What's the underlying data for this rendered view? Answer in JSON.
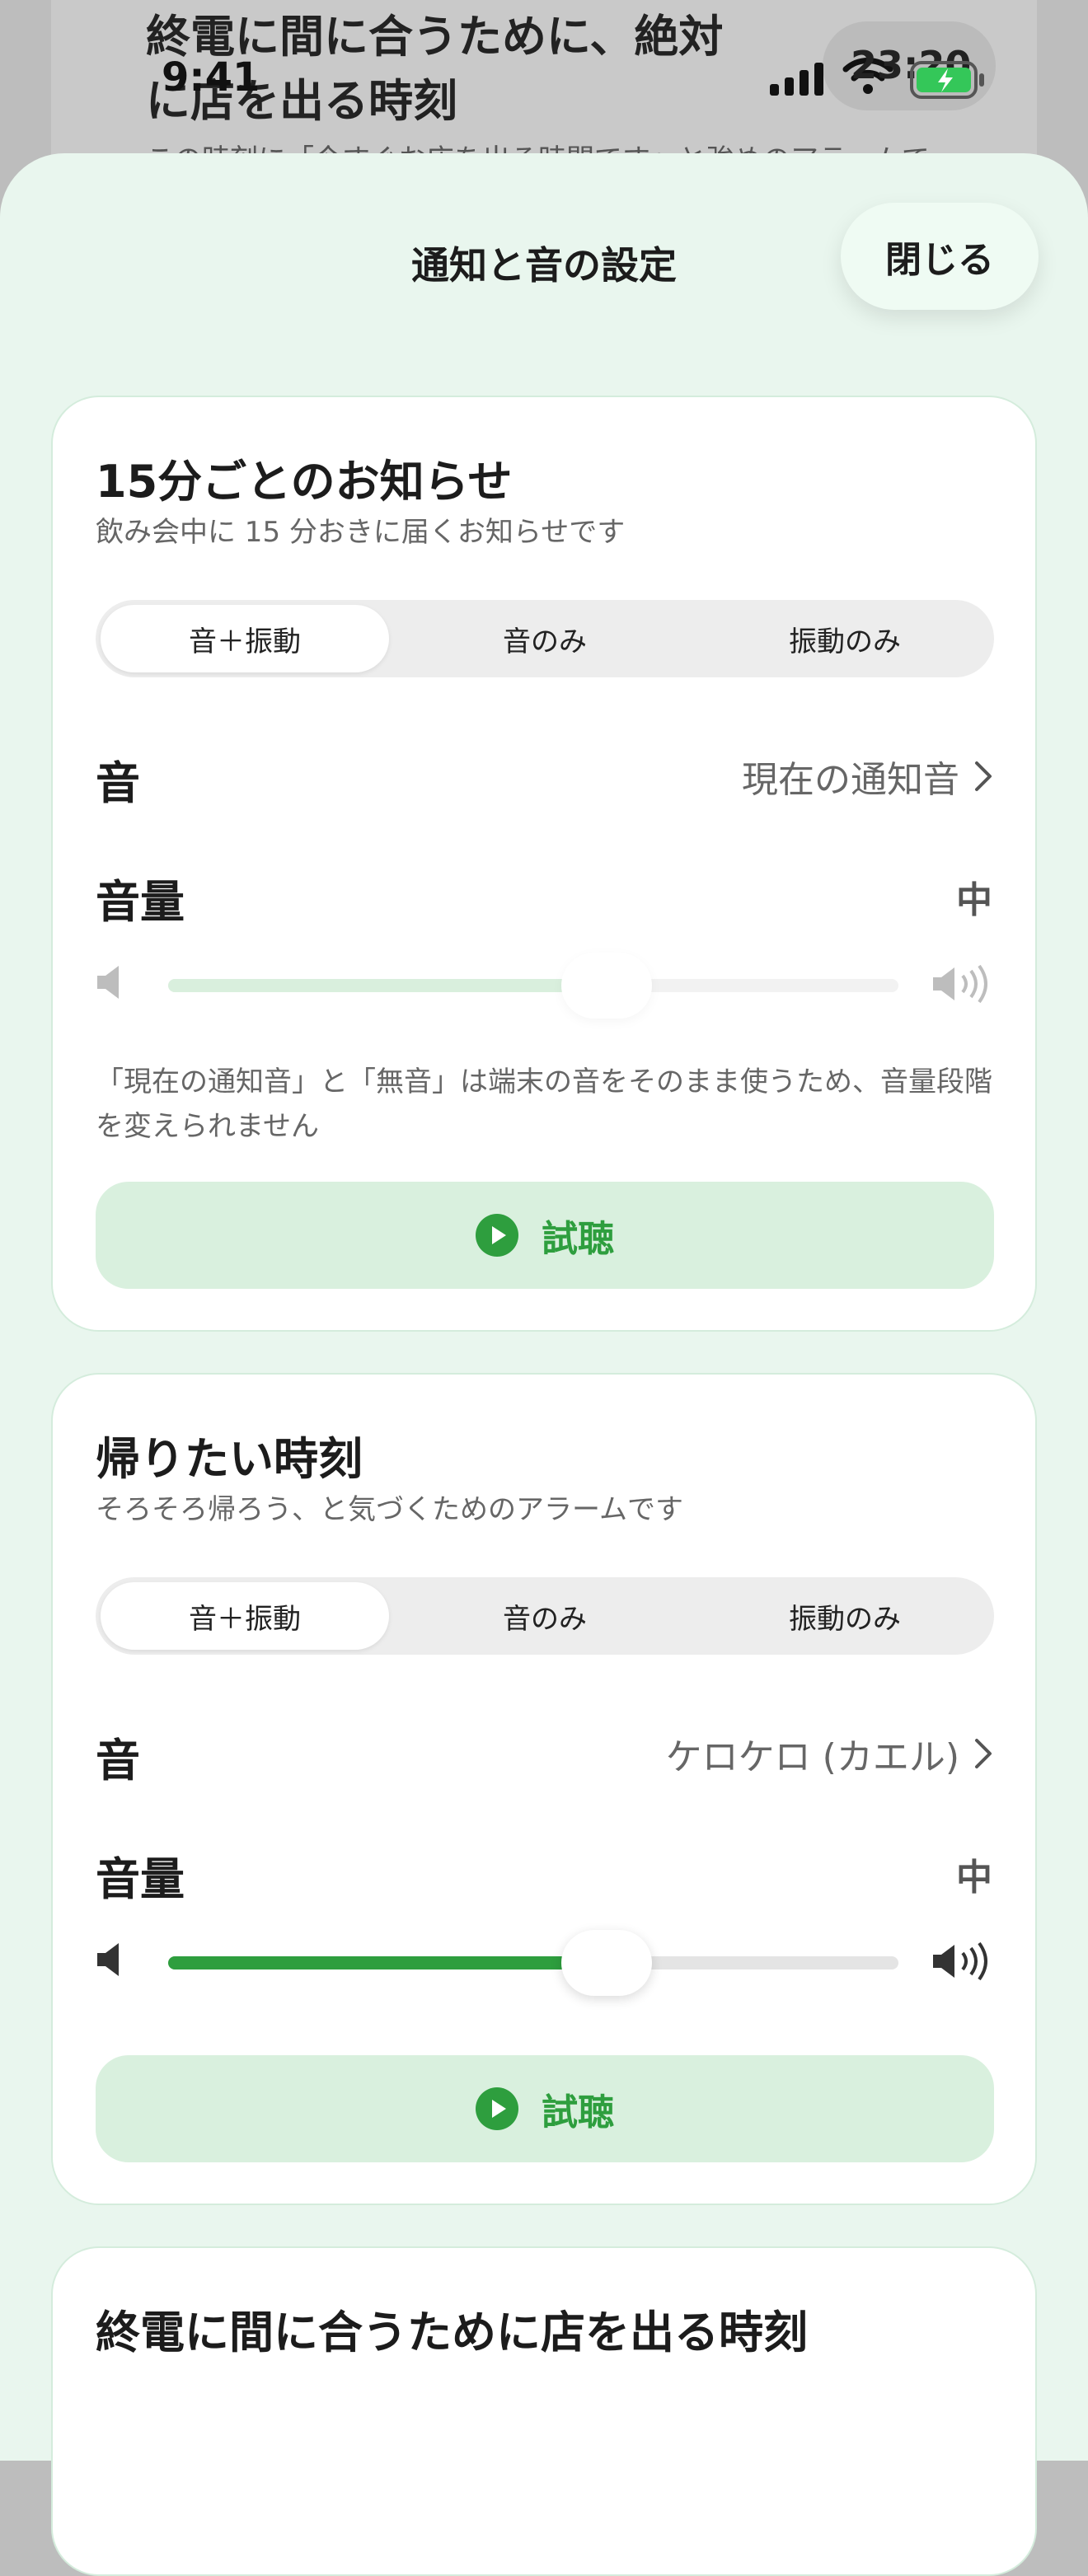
{
  "background_page": {
    "title": "終電に間に合うために、絶対に店を出る時刻",
    "subtitle": "この時刻に「今すぐお店を出る時間です」と強めのアラームで"
  },
  "status_bar": {
    "time": "9:41",
    "overlay_time": "23:20"
  },
  "sheet": {
    "title": "通知と音の設定",
    "close_label": "閉じる"
  },
  "segment_options": [
    "音＋振動",
    "音のみ",
    "振動のみ"
  ],
  "cards": [
    {
      "title": "15分ごとのお知らせ",
      "description": "飲み会中に 15 分おきに届くお知らせです",
      "selected_mode": "音＋振動",
      "sound_label": "音",
      "sound_value": "現在の通知音",
      "volume_label": "音量",
      "volume_value": "中",
      "volume_level": 0.6,
      "volume_enabled": false,
      "note": "「現在の通知音」と「無音」は端末の音をそのまま使うため、音量段階を変えられません",
      "preview_label": "試聴"
    },
    {
      "title": "帰りたい時刻",
      "description": "そろそろ帰ろう、と気づくためのアラームです",
      "selected_mode": "音＋振動",
      "sound_label": "音",
      "sound_value": "ケロケロ (カエル)",
      "volume_label": "音量",
      "volume_value": "中",
      "volume_level": 0.6,
      "volume_enabled": true,
      "preview_label": "試聴"
    },
    {
      "title": "終電に間に合うために店を出る時刻"
    }
  ],
  "colors": {
    "accent": "#2e9e3e",
    "sheet_bg": "#e9f6ee",
    "button_bg": "#d9f0de"
  }
}
